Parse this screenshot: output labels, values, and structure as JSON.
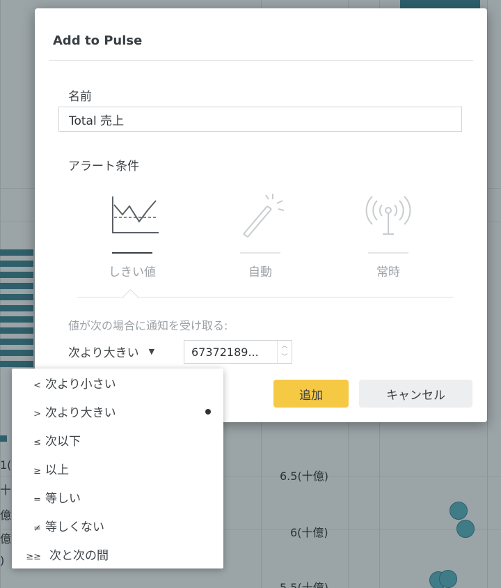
{
  "dialog": {
    "title": "Add to Pulse",
    "name_label": "名前",
    "name_value": "Total 売上",
    "alert_label": "アラート条件",
    "alert_options": [
      {
        "label": "しきい値",
        "icon": "threshold-chart-icon",
        "active": true
      },
      {
        "label": "自動",
        "icon": "magic-wand-icon",
        "active": false
      },
      {
        "label": "常時",
        "icon": "broadcast-antenna-icon",
        "active": false
      }
    ],
    "hint": "値が次の場合に通知を受け取る:",
    "condition_value": "次より大きい",
    "threshold_value": "67372189...",
    "add_button": "追加",
    "cancel_button": "キャンセル"
  },
  "dropdown": {
    "items": [
      {
        "symbol": "<",
        "label": "次より小さい",
        "selected": false
      },
      {
        "symbol": ">",
        "label": "次より大きい",
        "selected": true
      },
      {
        "symbol": "≤",
        "label": "次以下",
        "selected": false
      },
      {
        "symbol": "≥",
        "label": "以上",
        "selected": false
      },
      {
        "symbol": "=",
        "label": "等しい",
        "selected": false
      },
      {
        "symbol": "≠",
        "label": "等しくない",
        "selected": false
      },
      {
        "symbol": "≥≥",
        "label": "次と次の間",
        "selected": false
      }
    ]
  },
  "background": {
    "axis_labels": [
      "6.5(十億)",
      "6(十億)",
      "5.5(十億)"
    ],
    "fragments": [
      "1(",
      "十",
      "億",
      "億)",
      ")"
    ],
    "colors": {
      "bar": "#2f5f6b",
      "dot": "#3f7c87",
      "accent": "#f6c945"
    }
  }
}
